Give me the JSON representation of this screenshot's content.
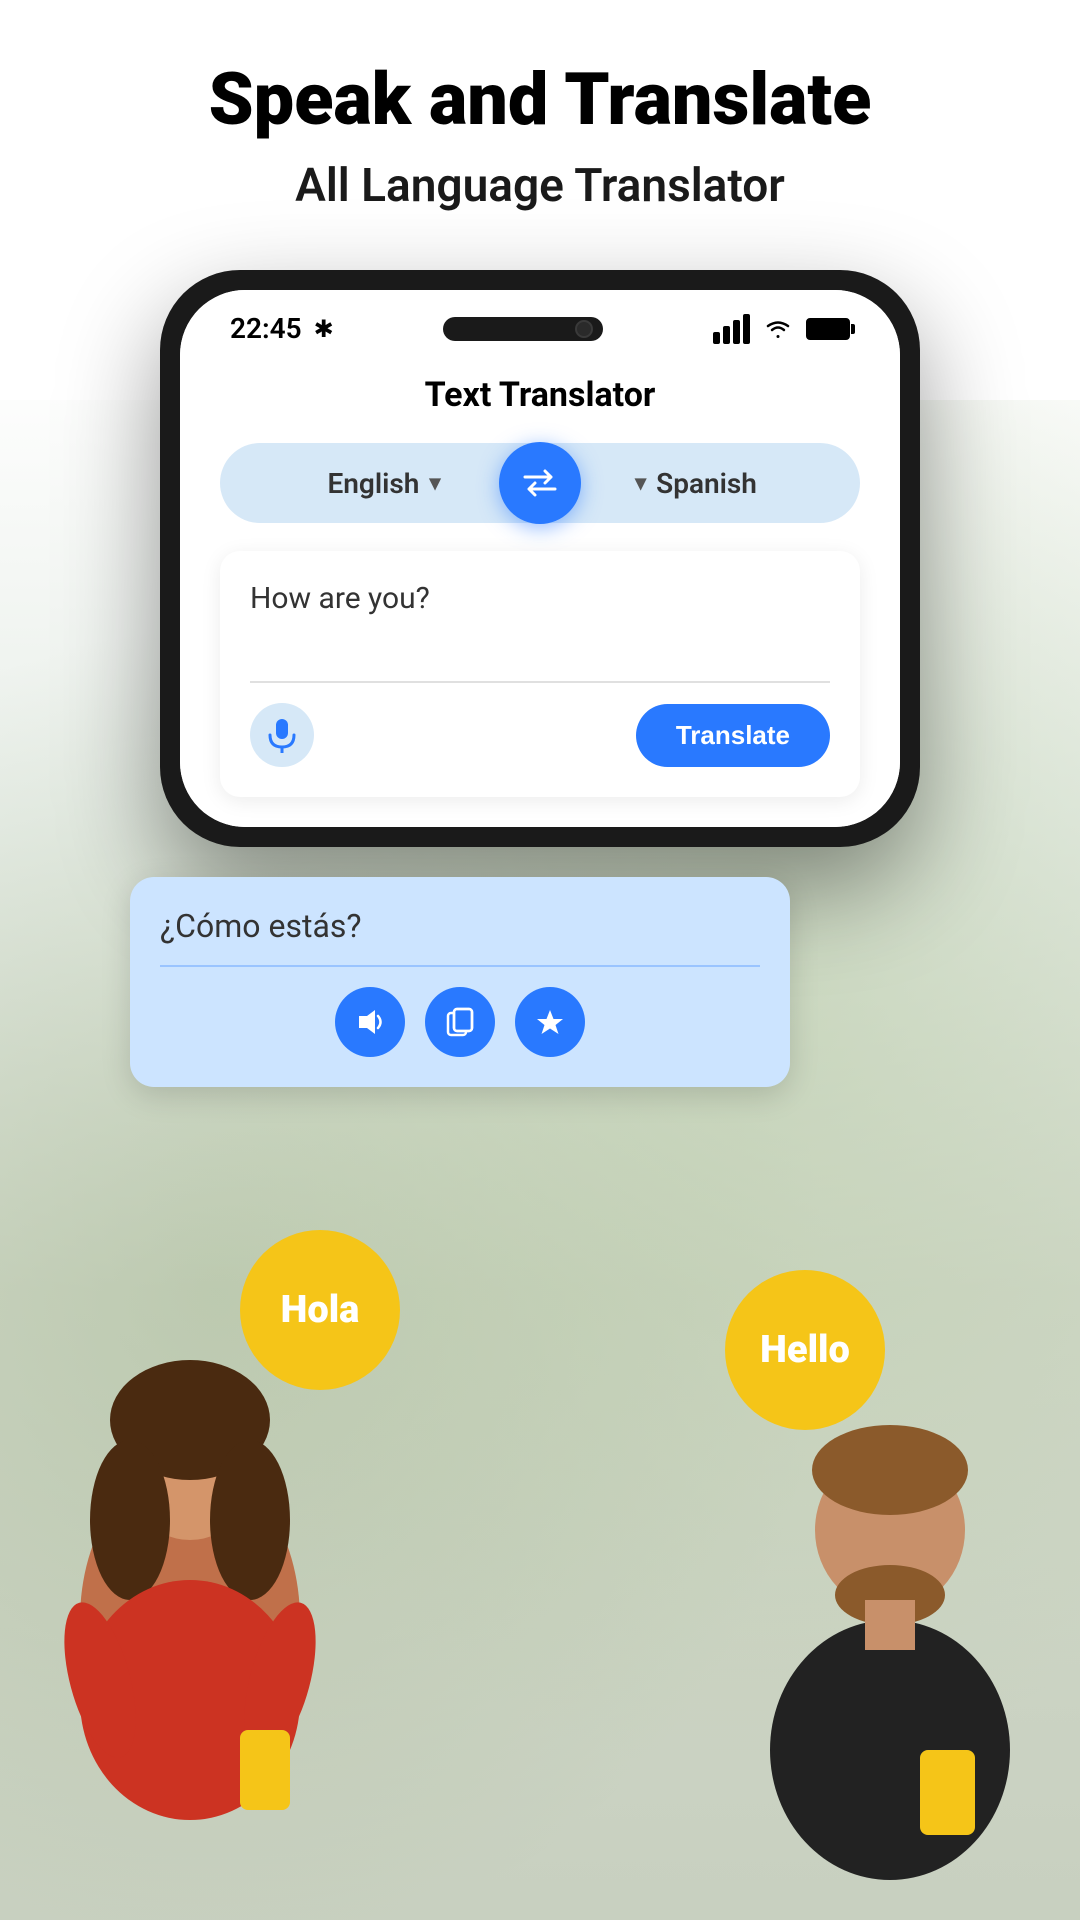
{
  "header": {
    "main_title": "Speak and Translate",
    "sub_title": "All Language Translator"
  },
  "status_bar": {
    "time": "22:45",
    "bluetooth": "✱"
  },
  "app": {
    "title": "Text Translator",
    "source_language": "English",
    "target_language": "Spanish",
    "input_text": "How are you?",
    "translated_text": "¿Cómo estás?",
    "translate_button": "Translate",
    "mic_label": "microphone",
    "swap_label": "swap languages",
    "speaker_label": "speaker",
    "copy_label": "copy",
    "favorite_label": "favorite"
  },
  "speech_bubbles": {
    "left_text": "Hola",
    "right_text": "Hello"
  },
  "colors": {
    "primary": "#2979ff",
    "bubble_yellow": "#f5c518",
    "lang_bg": "#d6e8f7",
    "result_bg": "#cce4ff"
  }
}
